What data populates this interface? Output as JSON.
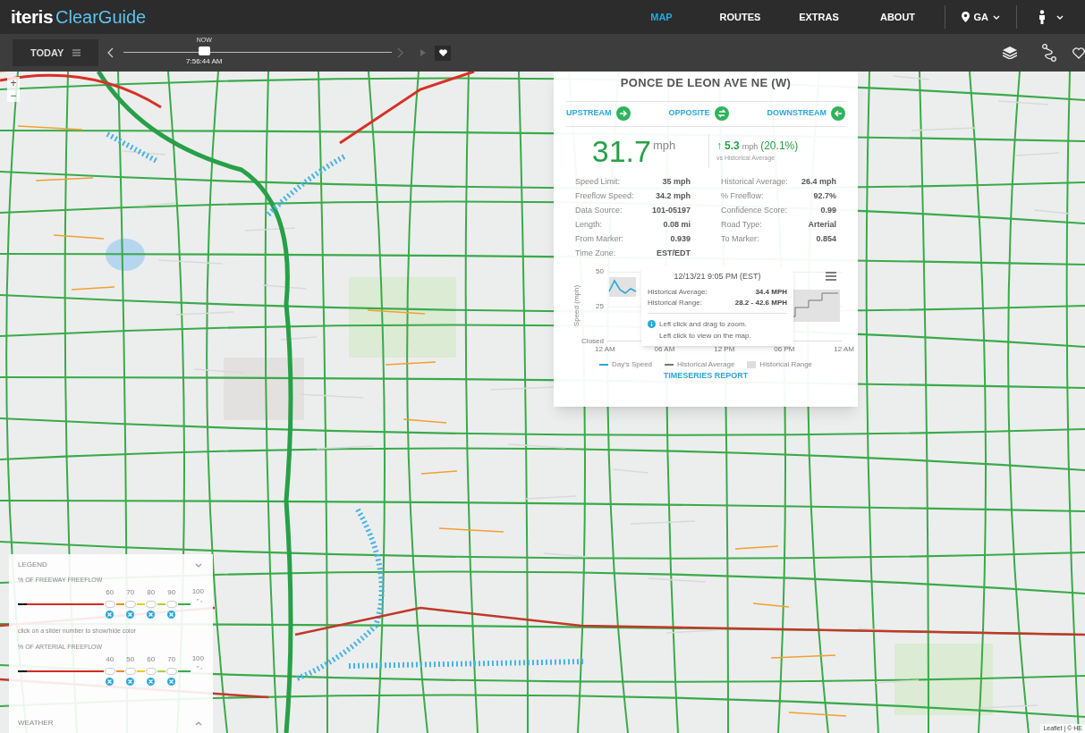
{
  "header": {
    "logo_brand": "iteris",
    "logo_product": "ClearGuide",
    "nav": [
      {
        "label": "MAP",
        "selected": true
      },
      {
        "label": "ROUTES",
        "selected": false
      },
      {
        "label": "EXTRAS",
        "selected": false
      },
      {
        "label": "ABOUT",
        "selected": false
      }
    ],
    "region": "GA"
  },
  "toolbar": {
    "period": "TODAY",
    "now_label": "NOW",
    "time": "7:56:44 AM",
    "time_slider": {
      "level": 0.3
    },
    "next_disabled": true,
    "play_disabled": true
  },
  "map": {
    "zoom_in": "+",
    "zoom_out": "−",
    "attribution": "Leaflet | © HE"
  },
  "popup": {
    "title": "PONCE DE LEON AVE NE (W)",
    "links": [
      {
        "label": "UPSTREAM",
        "kind": "right"
      },
      {
        "label": "OPPOSITE",
        "kind": "swap"
      },
      {
        "label": "DOWNSTREAM",
        "kind": "left"
      }
    ],
    "speed": "31.7",
    "speed_unit": "mph",
    "change_arrow": "↑",
    "change": "5.3",
    "change_unit": "mph",
    "change_pct": "(20.1%)",
    "change_note": "vs Historical Average",
    "stats_left": [
      {
        "label": "Speed Limit:",
        "value": "35 mph"
      },
      {
        "label": "Freeflow Speed:",
        "value": "34.2 mph"
      },
      {
        "label": "Data Source:",
        "value": "101-05197"
      },
      {
        "label": "Length:",
        "value": "0.08 mi"
      },
      {
        "label": "From Marker:",
        "value": "0.939"
      },
      {
        "label": "Time Zone:",
        "value": "EST/EDT"
      }
    ],
    "stats_right": [
      {
        "label": "Historical Average:",
        "value": "26.4 mph"
      },
      {
        "label": "% Freeflow:",
        "value": "92.7%"
      },
      {
        "label": "Confidence Score:",
        "value": "0.99"
      },
      {
        "label": "Road Type:",
        "value": "Arterial"
      },
      {
        "label": "To Marker:",
        "value": "0.854"
      }
    ],
    "chart": {
      "ylabel": "Speed (mph)",
      "yticks": [
        "50",
        "25",
        "Closed"
      ],
      "xticks": [
        "12 AM",
        "06 AM",
        "12 PM",
        "06 PM",
        "12 AM"
      ],
      "legend": [
        {
          "name": "Day's Speed",
          "color": "#2aa7d9",
          "kind": "line"
        },
        {
          "name": "Historical Average",
          "color": "#777777",
          "kind": "line"
        },
        {
          "name": "Historical Range",
          "color": "#dddddd",
          "kind": "band"
        }
      ]
    },
    "tooltip": {
      "title": "12/13/21 9:05 PM (EST)",
      "rows": [
        {
          "label": "Historical Average:",
          "value": "34.4 MPH"
        },
        {
          "label": "Historical Range:",
          "value": "28.2 - 42.6 MPH"
        }
      ],
      "hint_lines": [
        "Left click and drag to zoom.",
        "Left click to view on the map."
      ]
    },
    "report_link": "TIMESERIES REPORT"
  },
  "legend": {
    "title": "LEGEND",
    "expanded": true,
    "groups": [
      {
        "title": "% OF FREEWAY FREEFLOW",
        "thresholds": [
          "60",
          "70",
          "80",
          "90"
        ],
        "max": "100"
      },
      {
        "title": "% OF ARTERIAL FREEFLOW",
        "thresholds": [
          "40",
          "50",
          "60",
          "70"
        ],
        "max": "100"
      }
    ],
    "hint": "click on a slider number to show/hide color",
    "weather": "WEATHER",
    "weather_expanded": false
  }
}
